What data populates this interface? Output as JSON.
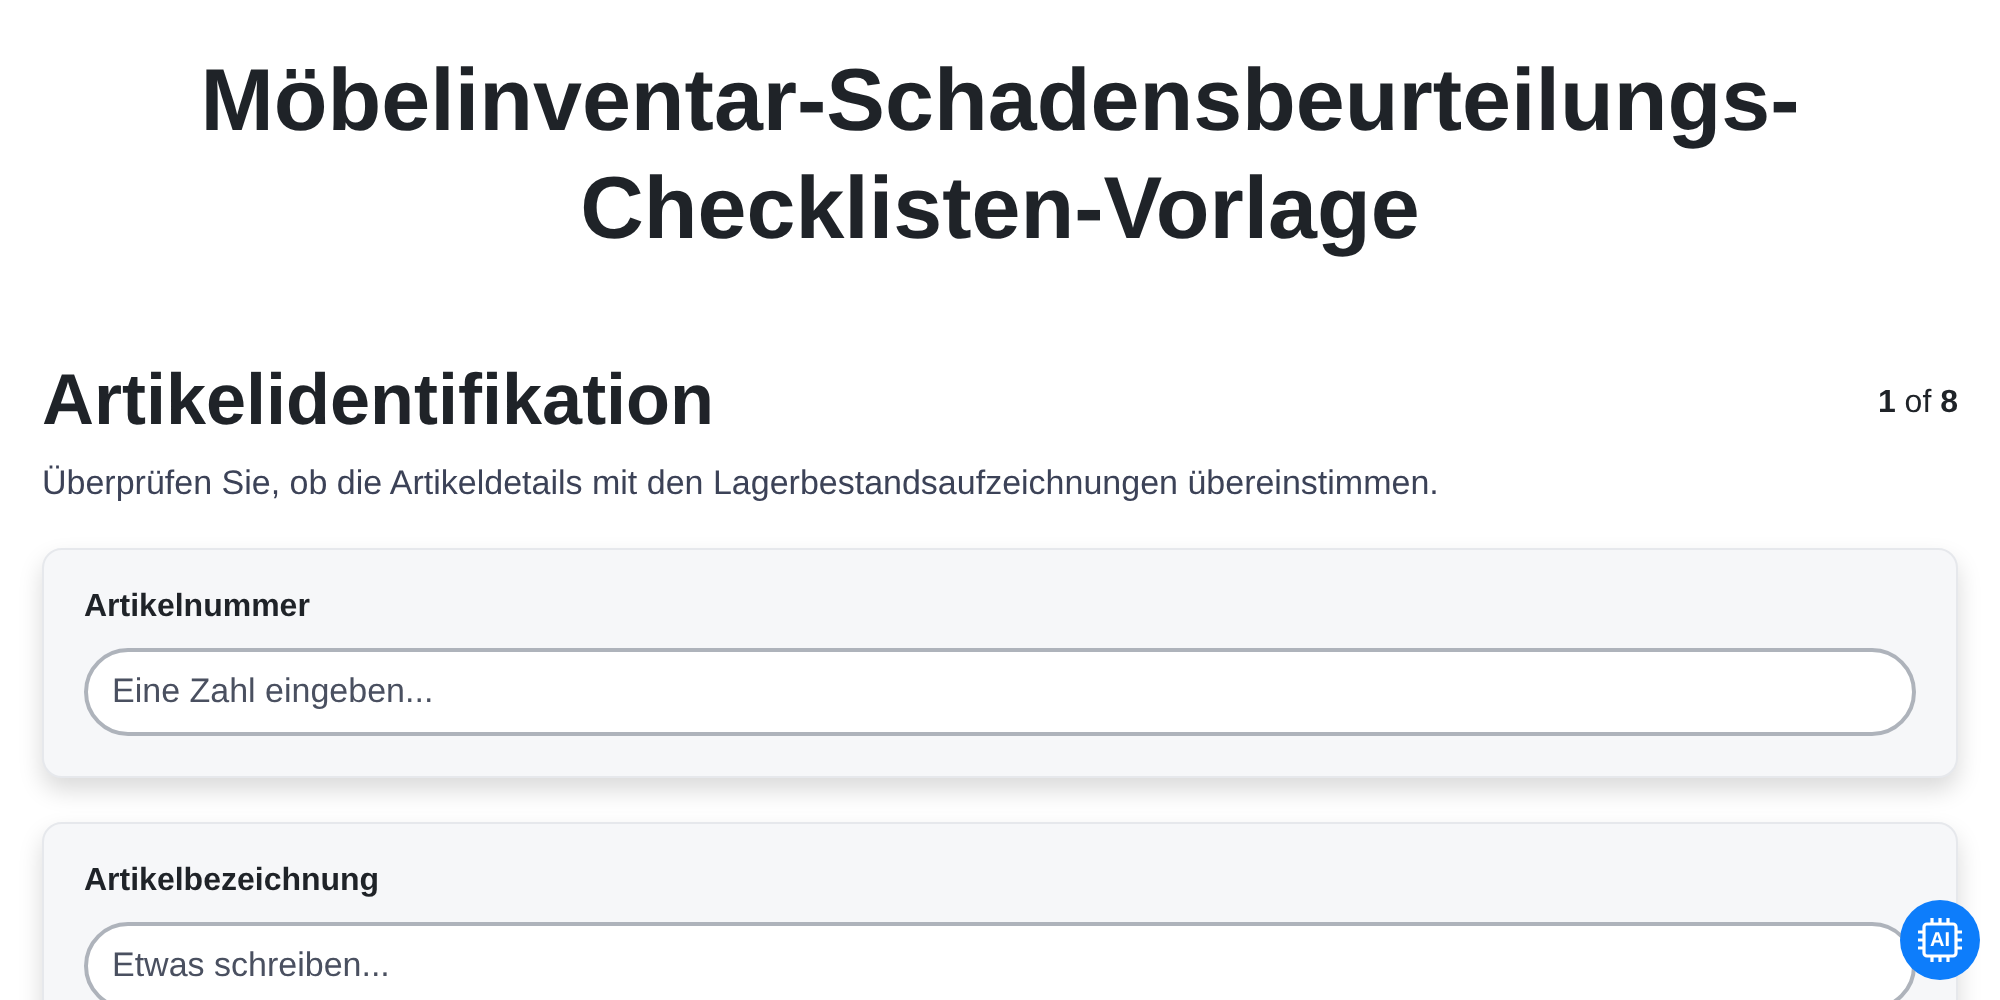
{
  "title": "Möbelinventar-Schadensbeurteilungs-Checklisten-Vorlage",
  "section": {
    "heading": "Artikelidentifikation",
    "progress": "**1** of **8**",
    "description": "Überprüfen Sie, ob die Artikeldetails mit den Lagerbestandsaufzeichnungen übereinstimmen."
  },
  "fields": [
    {
      "label": "Artikelnummer",
      "placeholder": "Eine Zahl eingeben..."
    },
    {
      "label": "Artikelbezeichnung",
      "placeholder": "Etwas schreiben..."
    }
  ],
  "ai_badge": {
    "label": "AI"
  }
}
